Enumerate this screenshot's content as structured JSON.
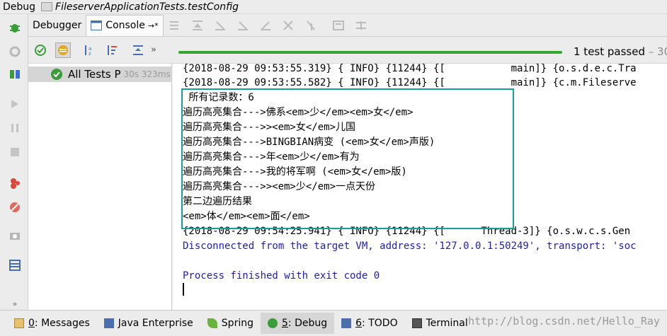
{
  "title": {
    "app": "Debug",
    "config": "FileserverApplicationTests.testConfig"
  },
  "toolbar": {
    "debugger_tab": "Debugger",
    "console_tab": "Console",
    "console_tab_arrow": "→*"
  },
  "toolbar2": {
    "more": "»",
    "status": "1 test passed",
    "status_suffix": " – 30",
    "progress": 1.0
  },
  "tree": {
    "label": "All Tests P",
    "time": "30s 323ms"
  },
  "console": {
    "lines": [
      "{2018-08-29 09:53:55.319} { INFO} {11244} {[           main]} {o.s.d.e.c.Tra",
      "{2018-08-29 09:53:55.582} { INFO} {11244} {[           main]} {c.m.Fileserve",
      " 所有记录数：6",
      "遍历高亮集合--->佛系<em>少</em><em>女</em>",
      "遍历高亮集合--->><em>女</em>儿国",
      "遍历高亮集合--->BINGBIAN病变 (<em>女</em>声版)",
      "遍历高亮集合--->年<em>少</em>有为",
      "遍历高亮集合--->我的将军啊 (<em>女</em>版)",
      "遍历高亮集合--->><em>少</em>一点天份",
      "第二边遍历结果",
      "<em>体</em><em>面</em>",
      "{2018-08-29 09:54:25.941} { INFO} {11244} {[      Thread-3]} {o.s.w.c.s.Gen",
      "Disconnected from the target VM, address: '127.0.0.1:50249', transport: 'soc",
      "",
      "Process finished with exit code 0"
    ]
  },
  "bottombar": {
    "messages_num": "0",
    "messages": ": Messages",
    "java_enterprise": "Java Enterprise",
    "spring": "Spring",
    "debug_num": "5",
    "debug": ": Debug",
    "todo_num": "6",
    "todo": ": TODO",
    "terminal": "Terminal",
    "watermark": "http://blog.csdn.net/Hello_Ray"
  },
  "colors": {
    "pass_green": "#37a62e",
    "highlight_box": "#1a9d9d",
    "console_blue": "#1f1fb5"
  }
}
